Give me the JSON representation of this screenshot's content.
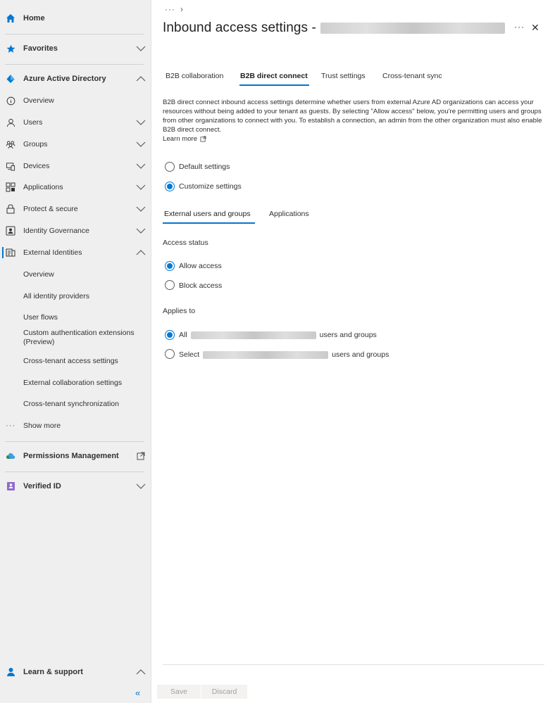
{
  "sidebar": {
    "home": "Home",
    "favorites": "Favorites",
    "aad": "Azure Active Directory",
    "overview": "Overview",
    "users": "Users",
    "groups": "Groups",
    "devices": "Devices",
    "applications": "Applications",
    "protect": "Protect & secure",
    "identity_gov": "Identity Governance",
    "external_identities": "External Identities",
    "ext_overview": "Overview",
    "all_idp": "All identity providers",
    "user_flows": "User flows",
    "custom_auth_1": "Custom authentication extensions",
    "custom_auth_2": "(Preview)",
    "cross_tenant_access": "Cross-tenant access settings",
    "external_collab": "External collaboration settings",
    "cross_tenant_sync": "Cross-tenant synchronization",
    "show_more": "Show more",
    "permissions": "Permissions Management",
    "verified_id": "Verified ID",
    "learn_support": "Learn & support",
    "collapse": "«"
  },
  "header": {
    "breadcrumb_more": "···",
    "breadcrumb_sep": "›",
    "title": "Inbound access settings -",
    "more": "···",
    "close": "✕"
  },
  "tabs": [
    "B2B collaboration",
    "B2B direct connect",
    "Trust settings",
    "Cross-tenant sync"
  ],
  "description": "B2B direct connect inbound access settings determine whether users from external Azure AD organizations can access your resources without being added to your tenant as guests. By selecting \"Allow access\" below, you're permitting users and groups from other organizations to connect with you. To establish a connection, an admin from the other organization must also enable B2B direct connect.",
  "learn_more": "Learn more",
  "settings_mode": {
    "default": "Default settings",
    "customize": "Customize settings",
    "selected": "customize"
  },
  "subtabs": [
    "External users and groups",
    "Applications"
  ],
  "access_status": {
    "label": "Access status",
    "allow": "Allow access",
    "block": "Block access",
    "selected": "allow"
  },
  "applies_to": {
    "label": "Applies to",
    "all_prefix": "All",
    "all_suffix": "users and groups",
    "select_prefix": "Select",
    "select_suffix": "users and groups",
    "selected": "all"
  },
  "footer": {
    "save": "Save",
    "discard": "Discard"
  },
  "colors": {
    "accent": "#0078d4",
    "sidebar_bg": "#efefef"
  }
}
